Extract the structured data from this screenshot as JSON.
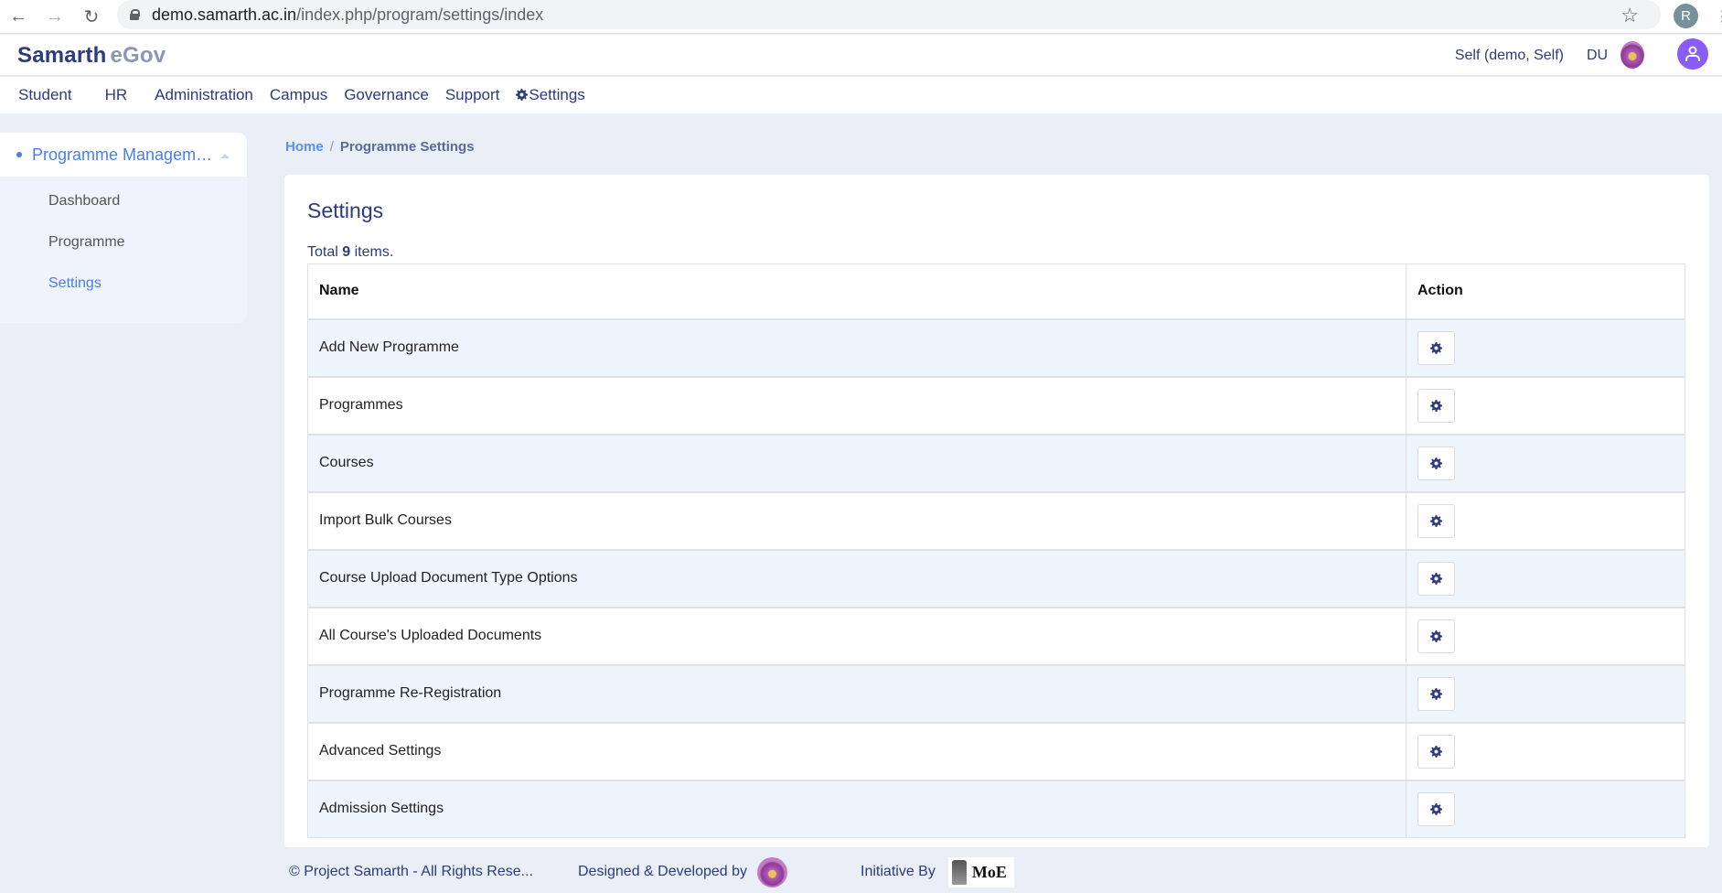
{
  "browser": {
    "url_host": "demo.samarth.ac.in",
    "url_path": "/index.php/program/settings/index",
    "profile_initial": "R"
  },
  "header": {
    "logo_main": "Samarth",
    "logo_sub": "eGov",
    "user": "Self (demo, Self)",
    "org": "DU"
  },
  "menu": [
    {
      "label": "Student"
    },
    {
      "label": "HR"
    },
    {
      "label": "Administration"
    },
    {
      "label": "Campus"
    },
    {
      "label": "Governance"
    },
    {
      "label": "Support"
    },
    {
      "label": "Settings"
    }
  ],
  "sidebar": {
    "section": "Programme Managem…",
    "items": [
      {
        "label": "Dashboard"
      },
      {
        "label": "Programme"
      },
      {
        "label": "Settings"
      }
    ]
  },
  "breadcrumb": {
    "home": "Home",
    "separator": "/",
    "current": "Programme Settings"
  },
  "main": {
    "title": "Settings",
    "summary_prefix": "Total ",
    "summary_count": "9",
    "summary_suffix": " items.",
    "columns": [
      "Name",
      "Action"
    ],
    "rows": [
      {
        "name": "Add New Programme"
      },
      {
        "name": "Programmes"
      },
      {
        "name": "Courses"
      },
      {
        "name": "Import Bulk Courses"
      },
      {
        "name": "Course Upload Document Type Options"
      },
      {
        "name": "All Course's Uploaded Documents"
      },
      {
        "name": "Programme Re-Registration"
      },
      {
        "name": "Advanced Settings"
      },
      {
        "name": "Admission Settings"
      }
    ]
  },
  "footer": {
    "copyright": "© Project Samarth - All Rights Rese...",
    "designed_by": "Designed & Developed by",
    "initiative_by": "Initiative By",
    "moe": "MoE"
  },
  "colors": {
    "brand": "#2d3a7c",
    "accent": "#4a7ee8",
    "page_bg": "#e9eef7",
    "row_alt": "#eef5fd",
    "user_icon": "#8a5cf6"
  }
}
